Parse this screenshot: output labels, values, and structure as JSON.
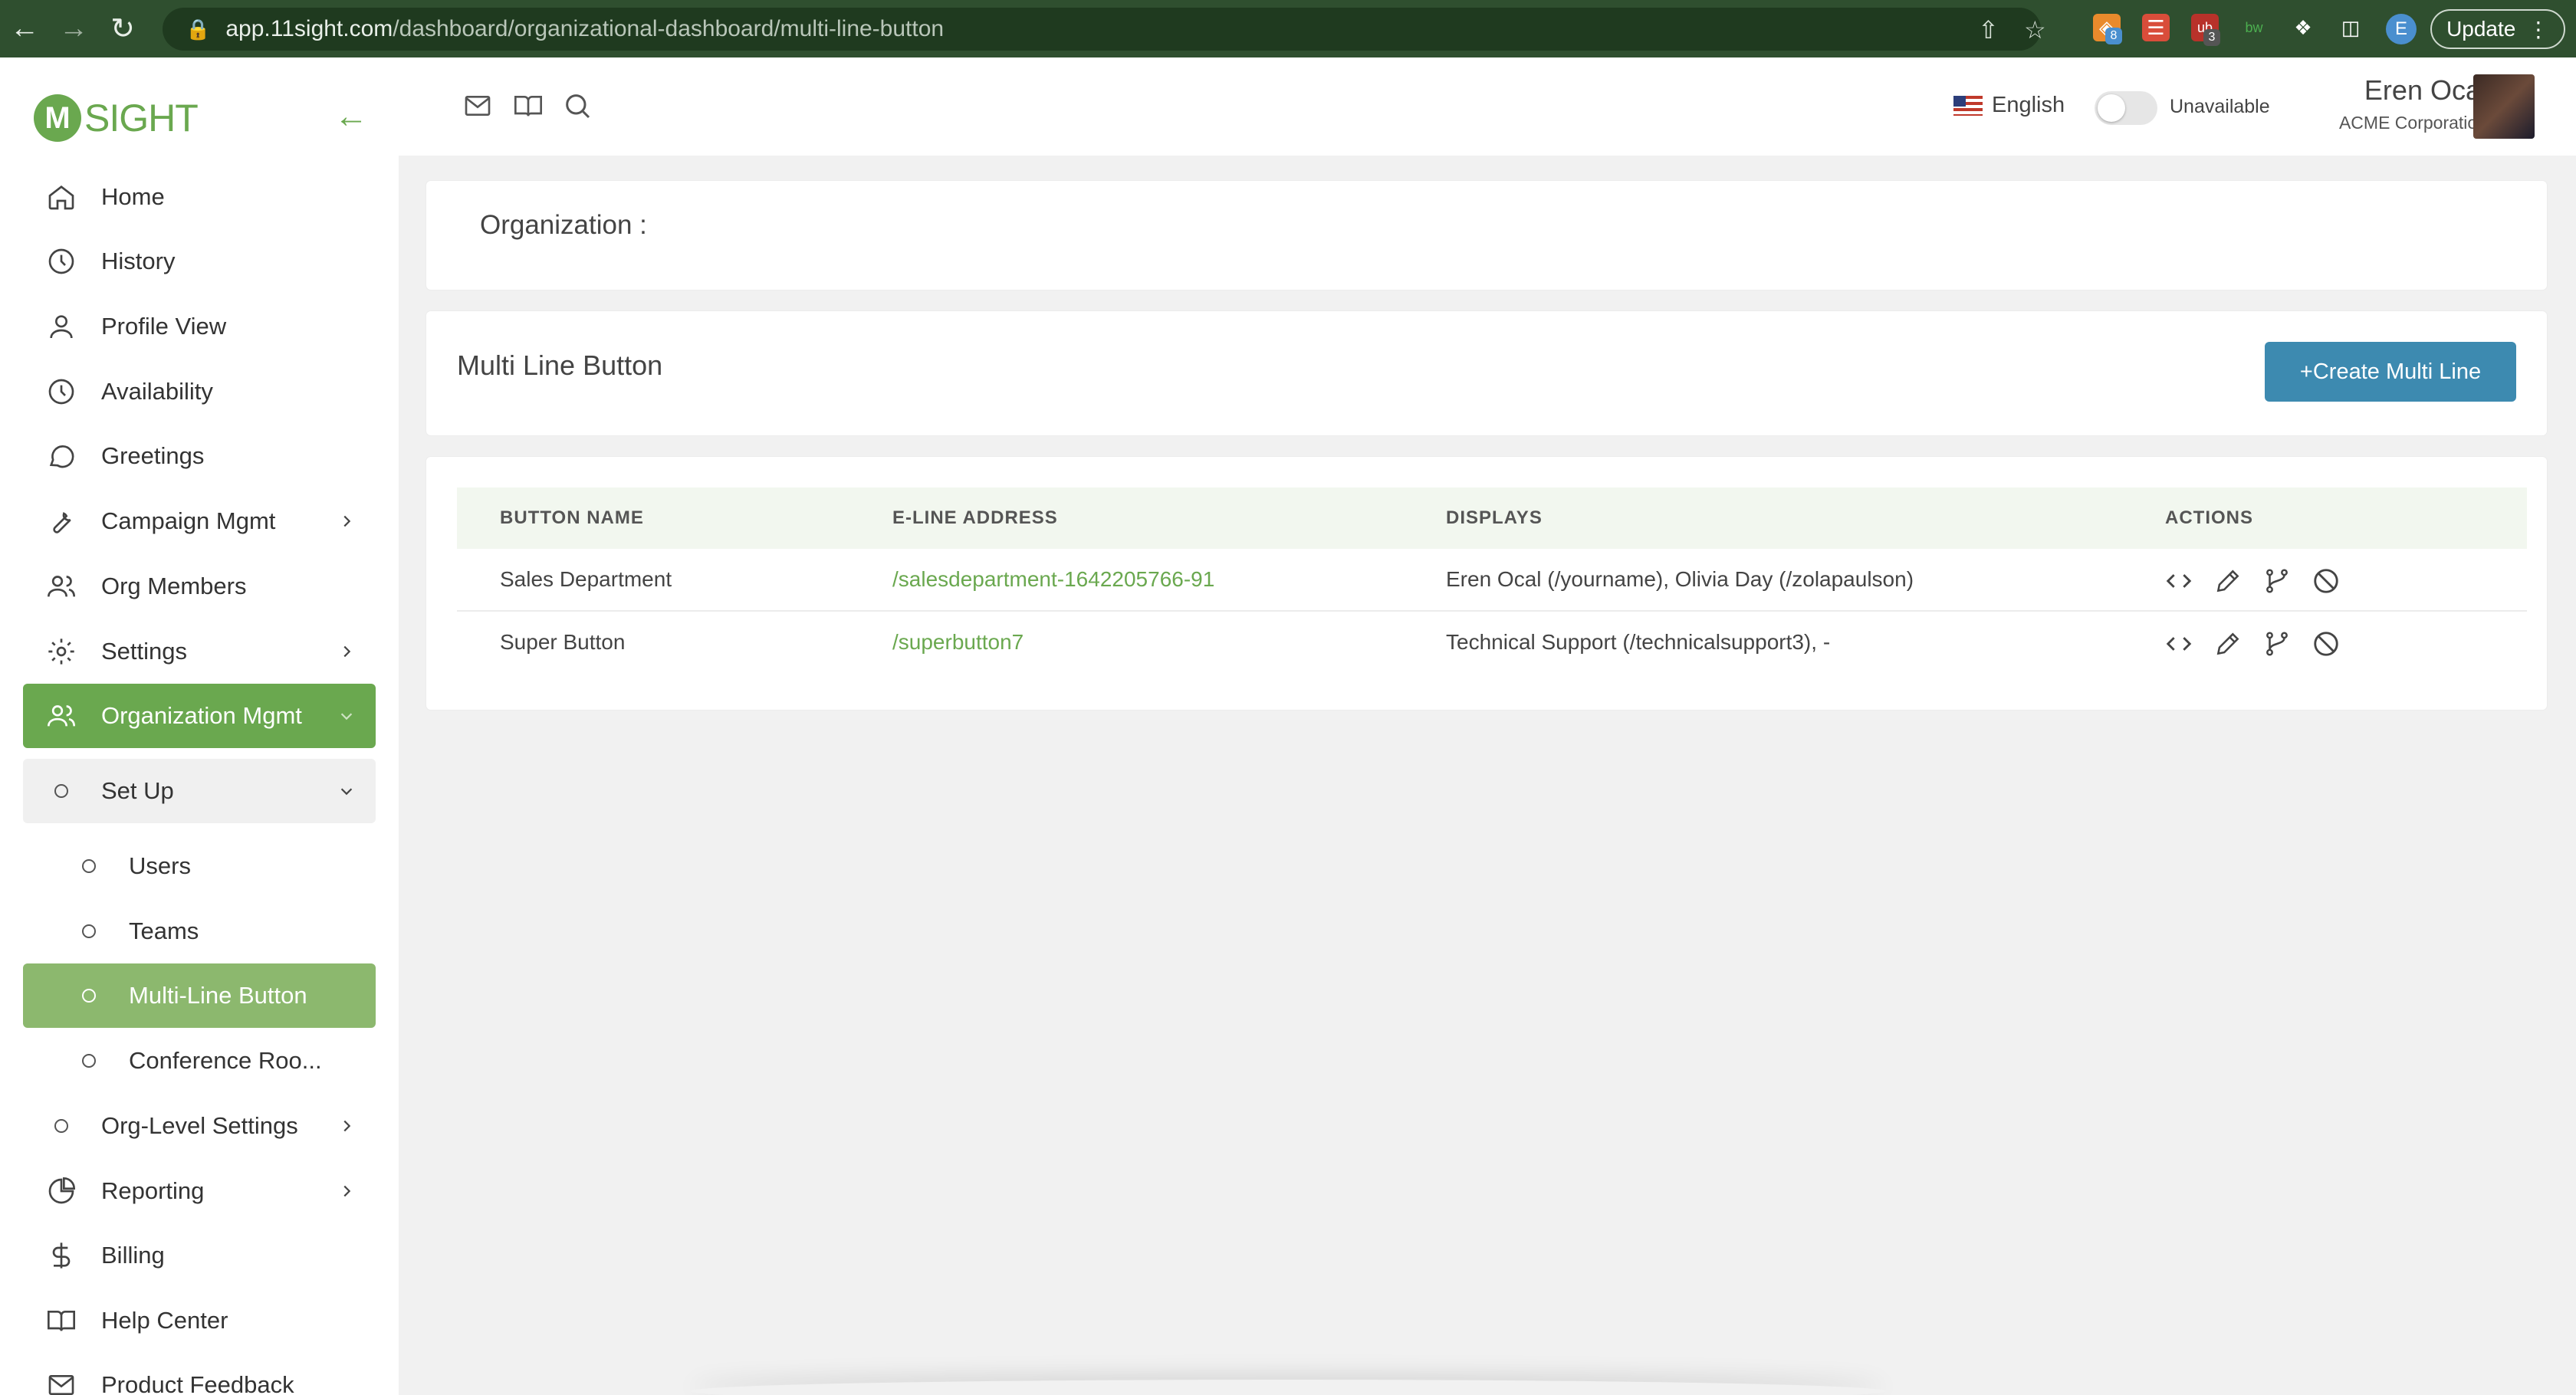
{
  "browser": {
    "url_host": "app.11sight.com",
    "url_path": "/dashboard/organizational-dashboard/multi-line-button",
    "update_label": "Update",
    "profile_initial": "E",
    "ext_badges": [
      "8",
      "3"
    ]
  },
  "sidebar": {
    "logo_text": "SIGHT",
    "items": [
      {
        "label": "Home",
        "icon": "home-icon"
      },
      {
        "label": "History",
        "icon": "clock-icon"
      },
      {
        "label": "Profile View",
        "icon": "user-icon"
      },
      {
        "label": "Availability",
        "icon": "clock-icon"
      },
      {
        "label": "Greetings",
        "icon": "chat-bubble-icon"
      },
      {
        "label": "Campaign Mgmt",
        "icon": "wrench-icon"
      },
      {
        "label": "Org Members",
        "icon": "users-icon"
      },
      {
        "label": "Settings",
        "icon": "gear-icon"
      },
      {
        "label": "Organization Mgmt",
        "icon": "users-icon"
      },
      {
        "label": "Set Up",
        "icon": "circle-icon"
      },
      {
        "label": "Users",
        "icon": "circle-icon"
      },
      {
        "label": "Teams",
        "icon": "circle-icon"
      },
      {
        "label": "Multi-Line Button",
        "icon": "circle-icon"
      },
      {
        "label": "Conference Roo...",
        "icon": "circle-icon"
      },
      {
        "label": "Org-Level Settings",
        "icon": "circle-icon"
      },
      {
        "label": "Reporting",
        "icon": "pie-chart-icon"
      },
      {
        "label": "Billing",
        "icon": "dollar-icon"
      },
      {
        "label": "Help Center",
        "icon": "book-icon"
      },
      {
        "label": "Product Feedback",
        "icon": "mail-icon"
      }
    ]
  },
  "header": {
    "language": "English",
    "availability": "Unavailable",
    "user_name": "Eren Ocal",
    "user_org": "ACME Corporation"
  },
  "main": {
    "org_label": "Organization :",
    "section_title": "Multi Line Button",
    "create_button": "+Create Multi Line",
    "table": {
      "columns": [
        "BUTTON NAME",
        "E-LINE ADDRESS",
        "DISPLAYS",
        "ACTIONS"
      ],
      "rows": [
        {
          "name": "Sales Department",
          "address": "/salesdepartment-1642205766-91",
          "displays": "Eren Ocal (/yourname), Olivia Day (/zolapaulson)"
        },
        {
          "name": "Super Button",
          "address": "/superbutton7",
          "displays": "Technical Support (/technicalsupport3), -"
        }
      ]
    }
  },
  "colors": {
    "accent_green": "#6aa84f",
    "button_blue": "#3d8ab0",
    "chrome_green": "#2f4f2f"
  }
}
